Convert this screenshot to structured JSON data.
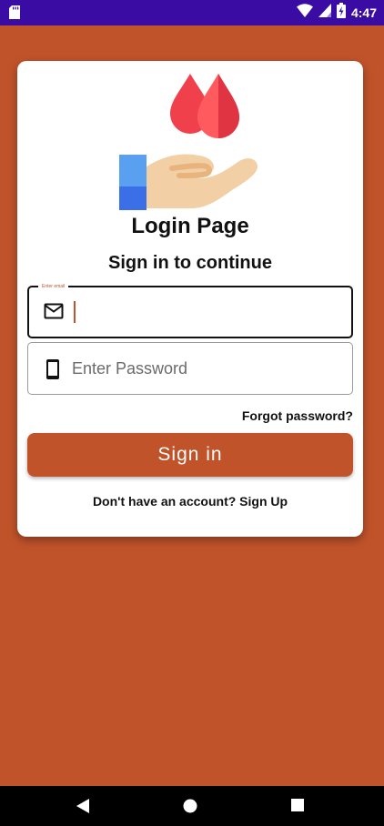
{
  "status_bar": {
    "time": "4:47",
    "icons": [
      "sd-card-icon",
      "wifi-icon",
      "signal-icon",
      "battery-charging-icon"
    ],
    "background": "#3a0ca3"
  },
  "app": {
    "background": "#c1532a",
    "accent": "#c1532a",
    "logo": "blood-donation-hand-icon"
  },
  "login": {
    "title": "Login Page",
    "subtitle": "Sign in to continue",
    "email_field": {
      "floating_label": "Enter email",
      "value": "",
      "icon": "mail-icon"
    },
    "password_field": {
      "placeholder": "Enter Password",
      "value": "",
      "icon": "phone-icon"
    },
    "forgot_password": "Forgot password?",
    "sign_in_label": "Sign in",
    "signup_prompt": "Don't have an account? Sign Up"
  },
  "nav_bar": {
    "buttons": [
      "back-icon",
      "home-icon",
      "recents-icon"
    ]
  }
}
